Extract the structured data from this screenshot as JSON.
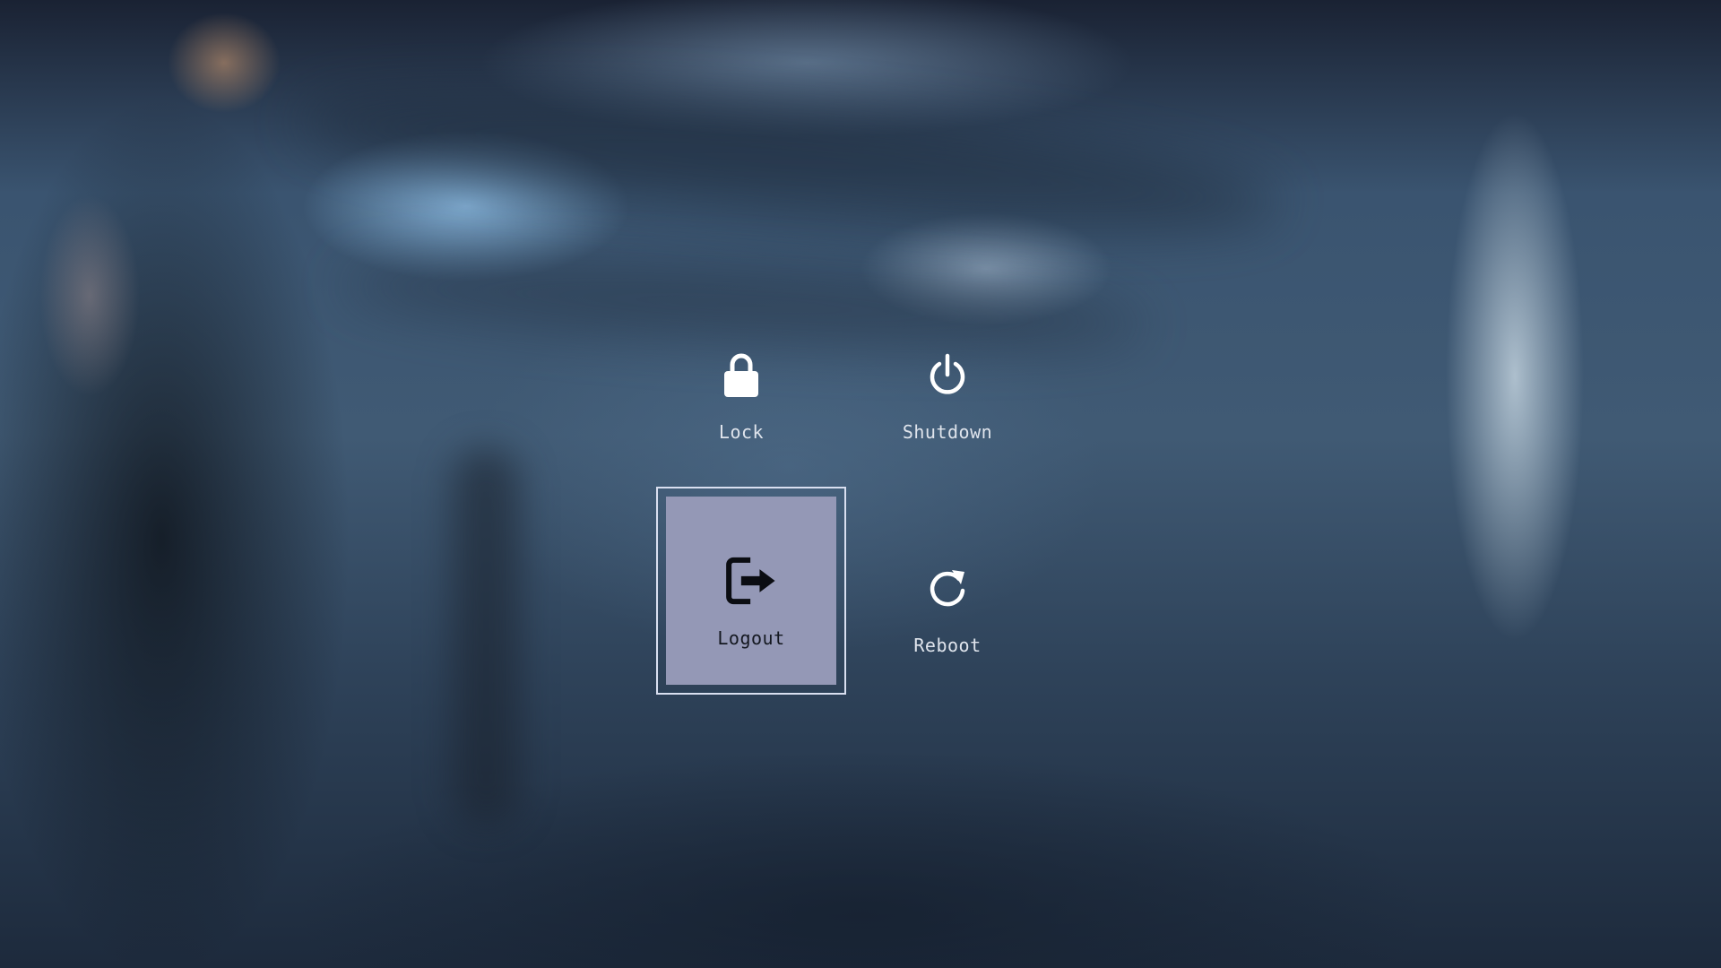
{
  "menu": {
    "items": [
      {
        "id": "lock",
        "label": "Lock",
        "icon": "lock-icon"
      },
      {
        "id": "shutdown",
        "label": "Shutdown",
        "icon": "power-icon"
      },
      {
        "id": "logout",
        "label": "Logout",
        "icon": "logout-icon",
        "selected": true
      },
      {
        "id": "reboot",
        "label": "Reboot",
        "icon": "reboot-icon"
      }
    ]
  },
  "colors": {
    "selected_fill": "#9498b6",
    "selected_border": "#d9dff0",
    "label_text": "#dfe4ec",
    "selected_label_text": "#141820"
  }
}
